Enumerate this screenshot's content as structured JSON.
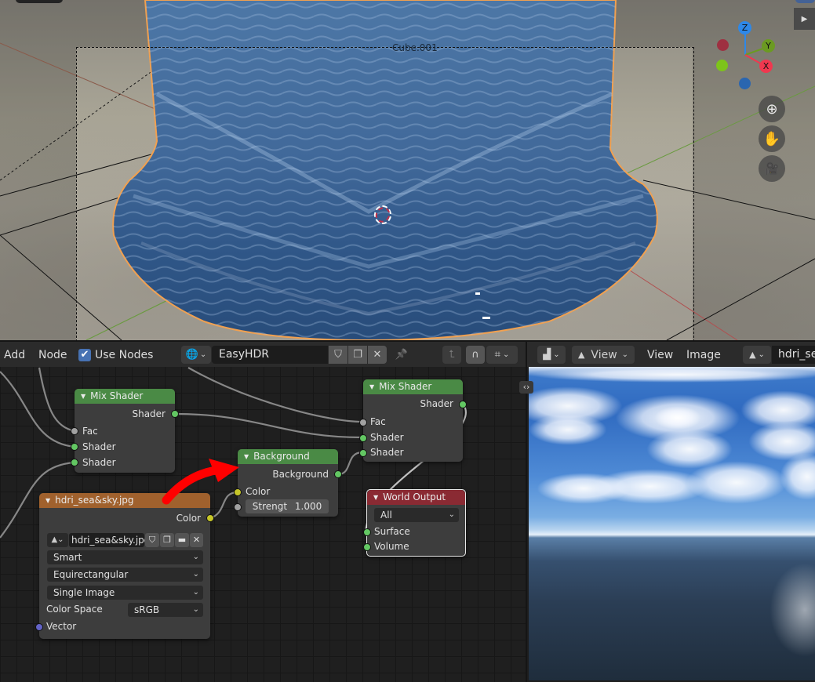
{
  "viewport": {
    "object_label": "Cube.001",
    "gizmo": {
      "z_label": "Z",
      "y_label": "Y",
      "x_label": "X"
    },
    "nav_buttons": [
      {
        "name": "zoom",
        "icon": "magnifier-plus-icon",
        "glyph": "⊕"
      },
      {
        "name": "pan",
        "icon": "hand-icon",
        "glyph": "✋"
      },
      {
        "name": "camera",
        "icon": "camera-icon",
        "glyph": "🎥"
      }
    ],
    "sidebar_toggle_glyph": "▶"
  },
  "node_editor": {
    "header": {
      "menu": [
        "Add",
        "Node"
      ],
      "use_nodes_label": "Use Nodes",
      "use_nodes_checked": true,
      "check_glyph": "✔",
      "world_type_glyph": "🌐",
      "dropdown_glyph": "⌄",
      "world_name": "EasyHDR",
      "fake_user_glyph": "⛉",
      "duplicate_glyph": "❐",
      "unlink_glyph": "✕",
      "pin_glyph": "📌",
      "parent_glyph": "⮤",
      "snap_glyph": "∩",
      "snap_mode_glyph": "⌗"
    },
    "nodes": {
      "mix_shader_1": {
        "title": "Mix Shader",
        "output": "Shader",
        "inputs": [
          "Fac",
          "Shader",
          "Shader"
        ]
      },
      "mix_shader_2": {
        "title": "Mix Shader",
        "output": "Shader",
        "inputs": [
          "Fac",
          "Shader",
          "Shader"
        ]
      },
      "background": {
        "title": "Background",
        "output": "Background",
        "color_label": "Color",
        "strength_label": "Strengt",
        "strength_value": "1.000"
      },
      "image_texture": {
        "title": "hdri_sea&sky.jpg",
        "output": "Color",
        "image_name": "hdri_sea&sky.jpg",
        "interpolation": "Smart",
        "projection": "Equirectangular",
        "extension": "Single Image",
        "color_space_label": "Color Space",
        "color_space": "sRGB",
        "vector_label": "Vector"
      },
      "world_output": {
        "title": "World Output",
        "target": "All",
        "inputs": [
          "Surface",
          "Volume"
        ]
      }
    },
    "colors": {
      "shader_header": "#4a8a45",
      "texture_header": "#a0612d",
      "output_header": "#8a2a33",
      "annotation_arrow": "#ff0000"
    }
  },
  "image_editor": {
    "header": {
      "editor_type_glyph": "▟",
      "view_mode": "View",
      "menu": [
        "View",
        "Image"
      ],
      "image_name": "hdri_se"
    },
    "collapse_glyph": "‹›"
  }
}
